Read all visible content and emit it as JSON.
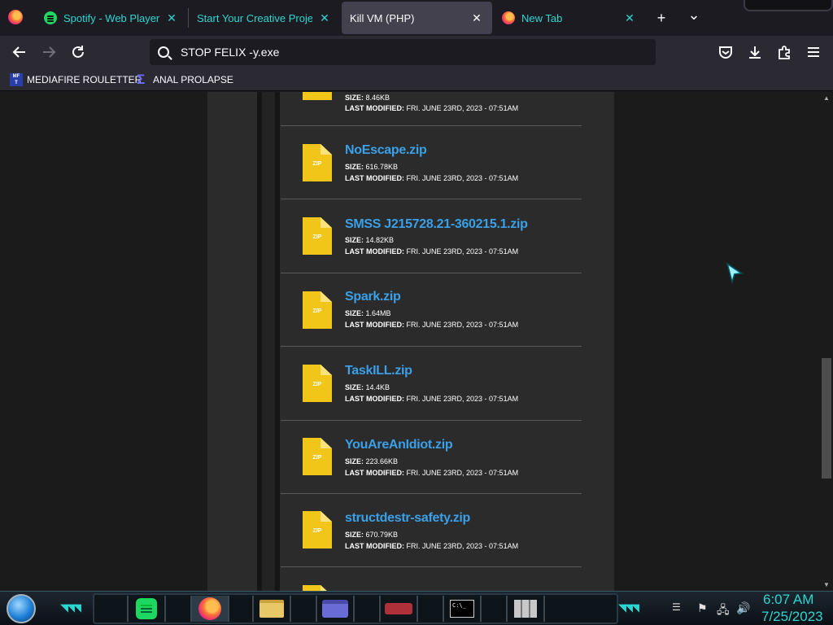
{
  "tabs": [
    {
      "label": "Spotify - Web Player: M",
      "icon": "spotify-icon",
      "active": false
    },
    {
      "label": "Start Your Creative Projects",
      "icon": "none",
      "active": false
    },
    {
      "label": "Kill VM (PHP)",
      "icon": "none",
      "active": true
    },
    {
      "label": "New Tab",
      "icon": "firefox-icon",
      "active": false
    }
  ],
  "tabstrip": {
    "new_tab": "+",
    "list_all": "⌄",
    "close": "✕"
  },
  "urlbar": {
    "value": "STOP FELIX -y.exe"
  },
  "bookmarks": [
    {
      "label": "MEDIAFIRE ROULETTER",
      "icon": "mediafire-icon"
    },
    {
      "label": "ANAL PROLAPSE",
      "icon": "sigma-icon"
    }
  ],
  "files": {
    "size_label": "SIZE:",
    "modified_label": "LAST MODIFIED:",
    "icon_text": "ZIP",
    "items": [
      {
        "name": "",
        "size": "8.46KB",
        "modified": "FRI. JUNE 23RD, 2023 - 07:51AM"
      },
      {
        "name": "NoEscape.zip",
        "size": "616.78KB",
        "modified": "FRI. JUNE 23RD, 2023 - 07:51AM"
      },
      {
        "name": "SMSS J215728.21-360215.1.zip",
        "size": "14.82KB",
        "modified": "FRI. JUNE 23RD, 2023 - 07:51AM"
      },
      {
        "name": "Spark.zip",
        "size": "1.64MB",
        "modified": "FRI. JUNE 23RD, 2023 - 07:51AM"
      },
      {
        "name": "TaskILL.zip",
        "size": "14.4KB",
        "modified": "FRI. JUNE 23RD, 2023 - 07:51AM"
      },
      {
        "name": "YouAreAnIdiot.zip",
        "size": "223.66KB",
        "modified": "FRI. JUNE 23RD, 2023 - 07:51AM"
      },
      {
        "name": "structdestr-safety.zip",
        "size": "670.79KB",
        "modified": "FRI. JUNE 23RD, 2023 - 07:51AM"
      }
    ]
  },
  "taskbar": {
    "apps": [
      "spotify-icon",
      "firefox-icon",
      "file-explorer-icon",
      "id-card-icon",
      "weapon-icon",
      "command-prompt-icon",
      "wall-icon"
    ],
    "cmd_text": "C:\\_",
    "clock": {
      "time": "6:07 AM",
      "date": "7/25/2023"
    }
  },
  "colors": {
    "accent": "#2bd6d0",
    "link": "#3aa0e8",
    "zip": "#f2c618"
  }
}
